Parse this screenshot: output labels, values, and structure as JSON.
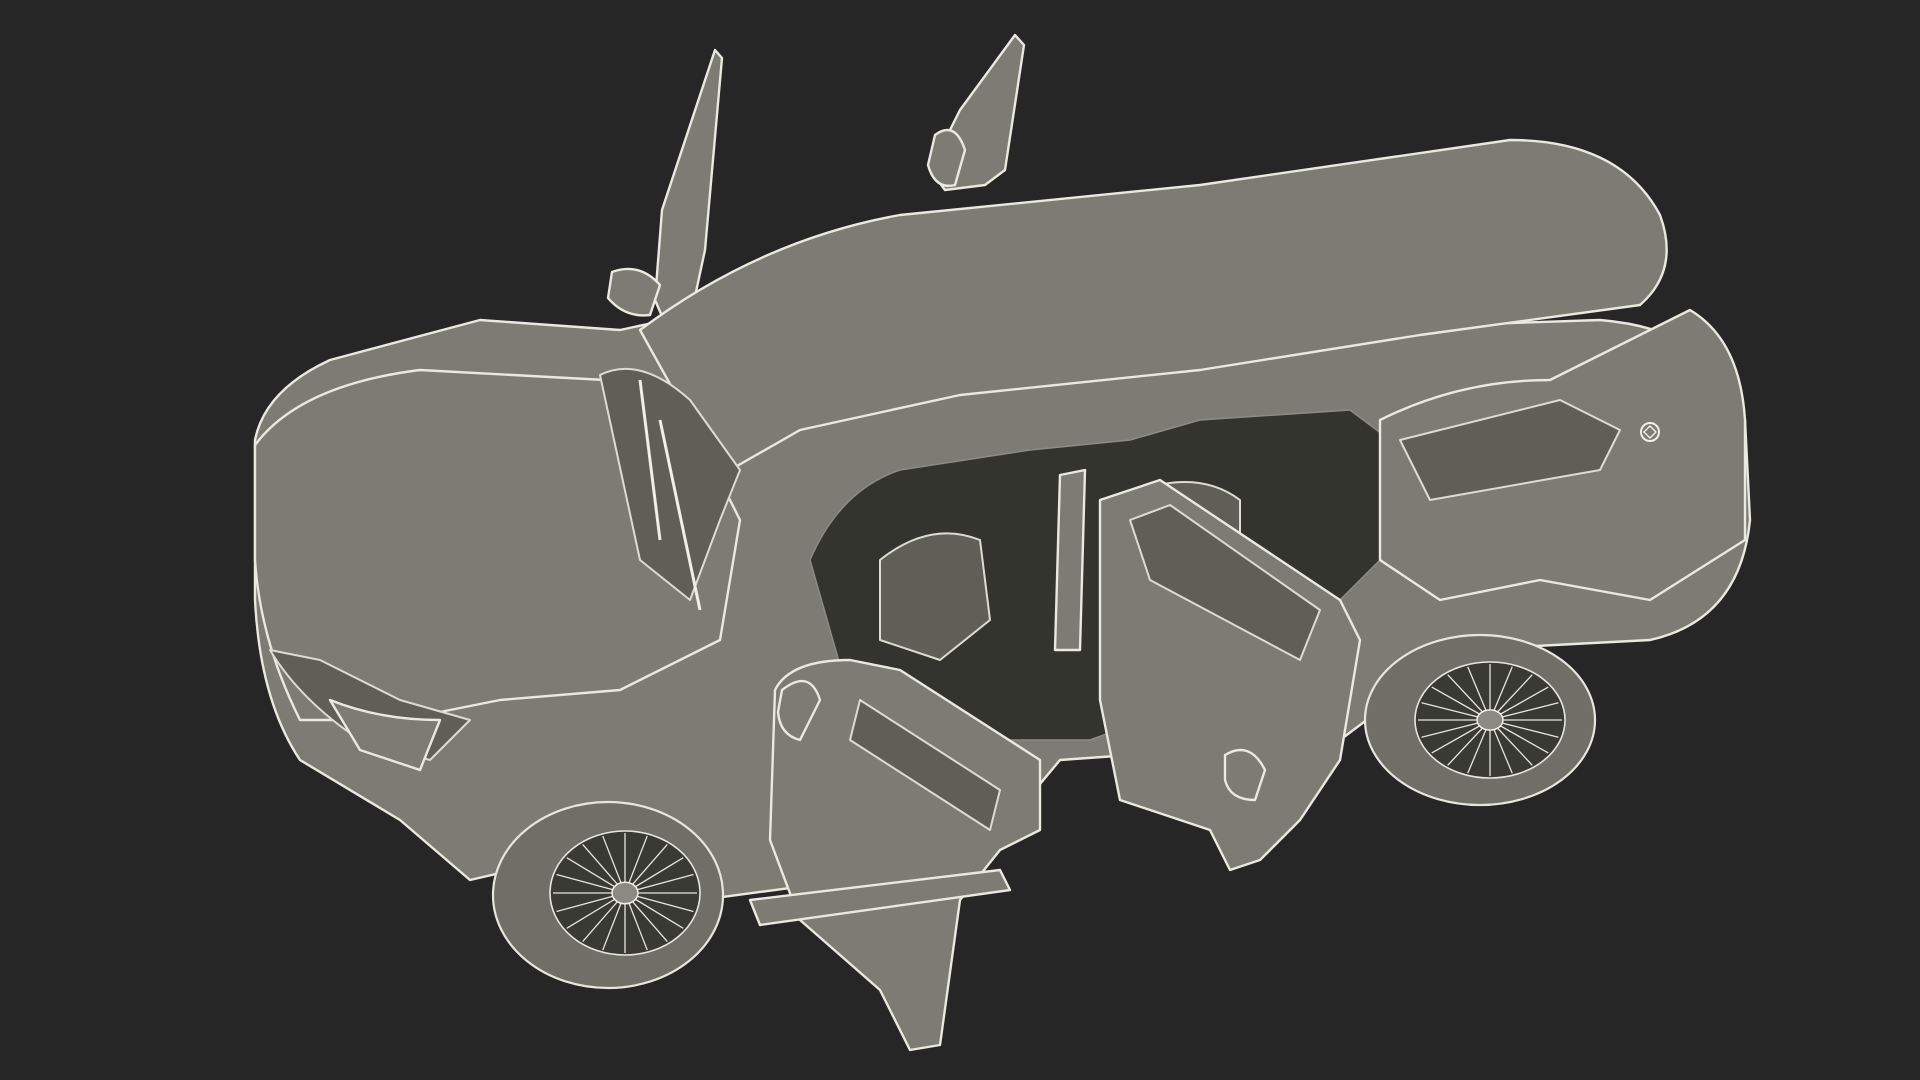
{
  "scene": {
    "subject": "",
    "background_color": "#262626",
    "wire_color": "#e9e9df",
    "surface_color": "#7c7c74"
  }
}
